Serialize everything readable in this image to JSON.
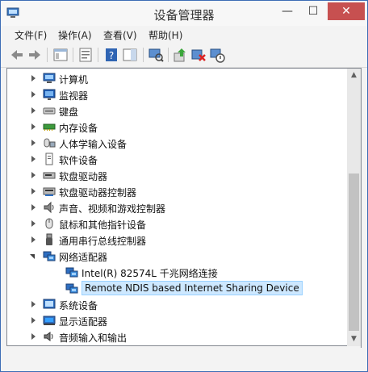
{
  "window": {
    "title": "设备管理器",
    "min_label": "—",
    "max_label": "☐",
    "close_label": "✕"
  },
  "menu": [
    "文件(F)",
    "操作(A)",
    "查看(V)",
    "帮助(H)"
  ],
  "toolbar": [
    "back-icon",
    "forward-icon",
    "show-hide-console-tree-icon",
    "properties-icon",
    "help-icon",
    "action-pane-icon",
    "scan-hardware-icon",
    "update-driver-icon",
    "uninstall-device-icon",
    "disable-device-icon"
  ],
  "tree": [
    {
      "label": "计算机",
      "icon": "computer-icon",
      "state": "collapsed"
    },
    {
      "label": "监视器",
      "icon": "monitor-icon",
      "state": "collapsed"
    },
    {
      "label": "键盘",
      "icon": "keyboard-icon",
      "state": "collapsed"
    },
    {
      "label": "内存设备",
      "icon": "memory-icon",
      "state": "collapsed"
    },
    {
      "label": "人体学输入设备",
      "icon": "hid-icon",
      "state": "collapsed"
    },
    {
      "label": "软件设备",
      "icon": "software-device-icon",
      "state": "collapsed"
    },
    {
      "label": "软盘驱动器",
      "icon": "floppy-drive-icon",
      "state": "collapsed"
    },
    {
      "label": "软盘驱动器控制器",
      "icon": "floppy-controller-icon",
      "state": "collapsed"
    },
    {
      "label": "声音、视频和游戏控制器",
      "icon": "speaker-icon",
      "state": "collapsed"
    },
    {
      "label": "鼠标和其他指针设备",
      "icon": "mouse-icon",
      "state": "collapsed"
    },
    {
      "label": "通用串行总线控制器",
      "icon": "usb-icon",
      "state": "collapsed"
    },
    {
      "label": "网络适配器",
      "icon": "network-adapter-icon",
      "state": "expanded"
    },
    {
      "label": "Intel(R) 82574L 千兆网络连接",
      "icon": "network-adapter-icon",
      "state": "child"
    },
    {
      "label": "Remote NDIS based Internet Sharing Device",
      "icon": "network-adapter-icon",
      "state": "child-selected"
    },
    {
      "label": "系统设备",
      "icon": "system-device-icon",
      "state": "collapsed"
    },
    {
      "label": "显示适配器",
      "icon": "display-adapter-icon",
      "state": "collapsed"
    },
    {
      "label": "音频输入和输出",
      "icon": "audio-io-icon",
      "state": "collapsed"
    }
  ]
}
